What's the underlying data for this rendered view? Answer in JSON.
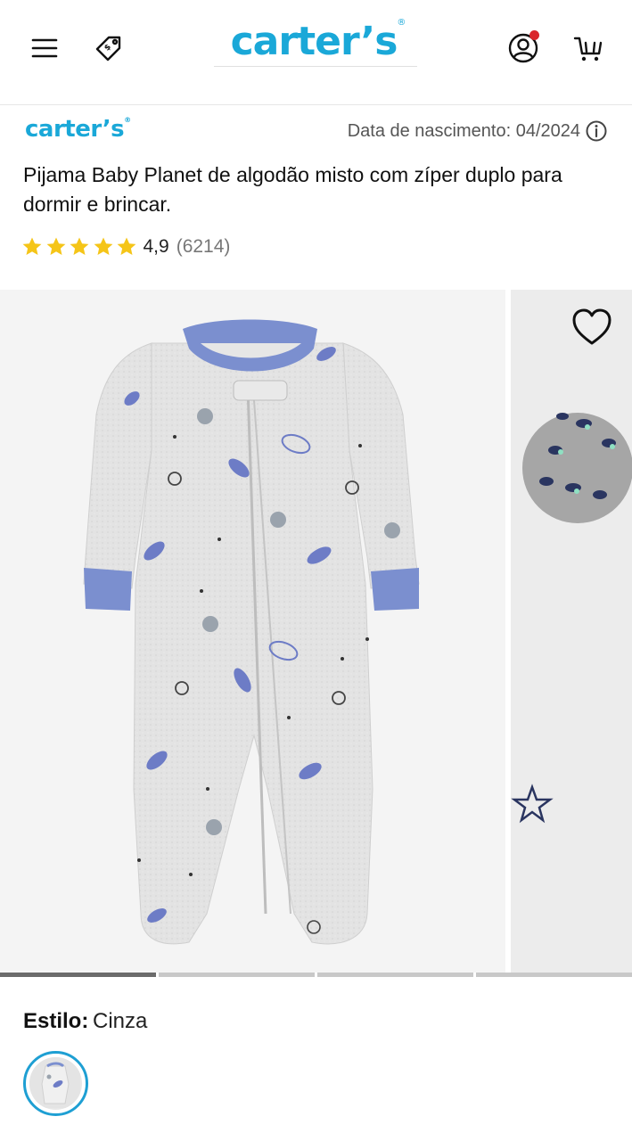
{
  "header": {
    "logo_text": "carter’s",
    "logo_mark": "®",
    "icons": [
      "menu-icon",
      "price-tag-icon",
      "account-icon",
      "cart-icon"
    ],
    "accent_color": "#1aa8d8",
    "notification_color": "#d9262c"
  },
  "product": {
    "brand_logo": "carter’s",
    "birth_date_label": "Data de nascimento: 04/2024",
    "title": "Pijama Baby Planet de algodão misto com zíper duplo para dormir e brincar.",
    "rating_value": "4,9",
    "rating_count": "(6214)",
    "stars": 5,
    "star_color": "#f5c518"
  },
  "gallery": {
    "slides": 4,
    "active_slide": 1,
    "favorite_icon": "heart-outline-icon"
  },
  "style": {
    "label": "Estilo:",
    "value": "Cinza",
    "swatch_border_color": "#1e9fd3"
  }
}
